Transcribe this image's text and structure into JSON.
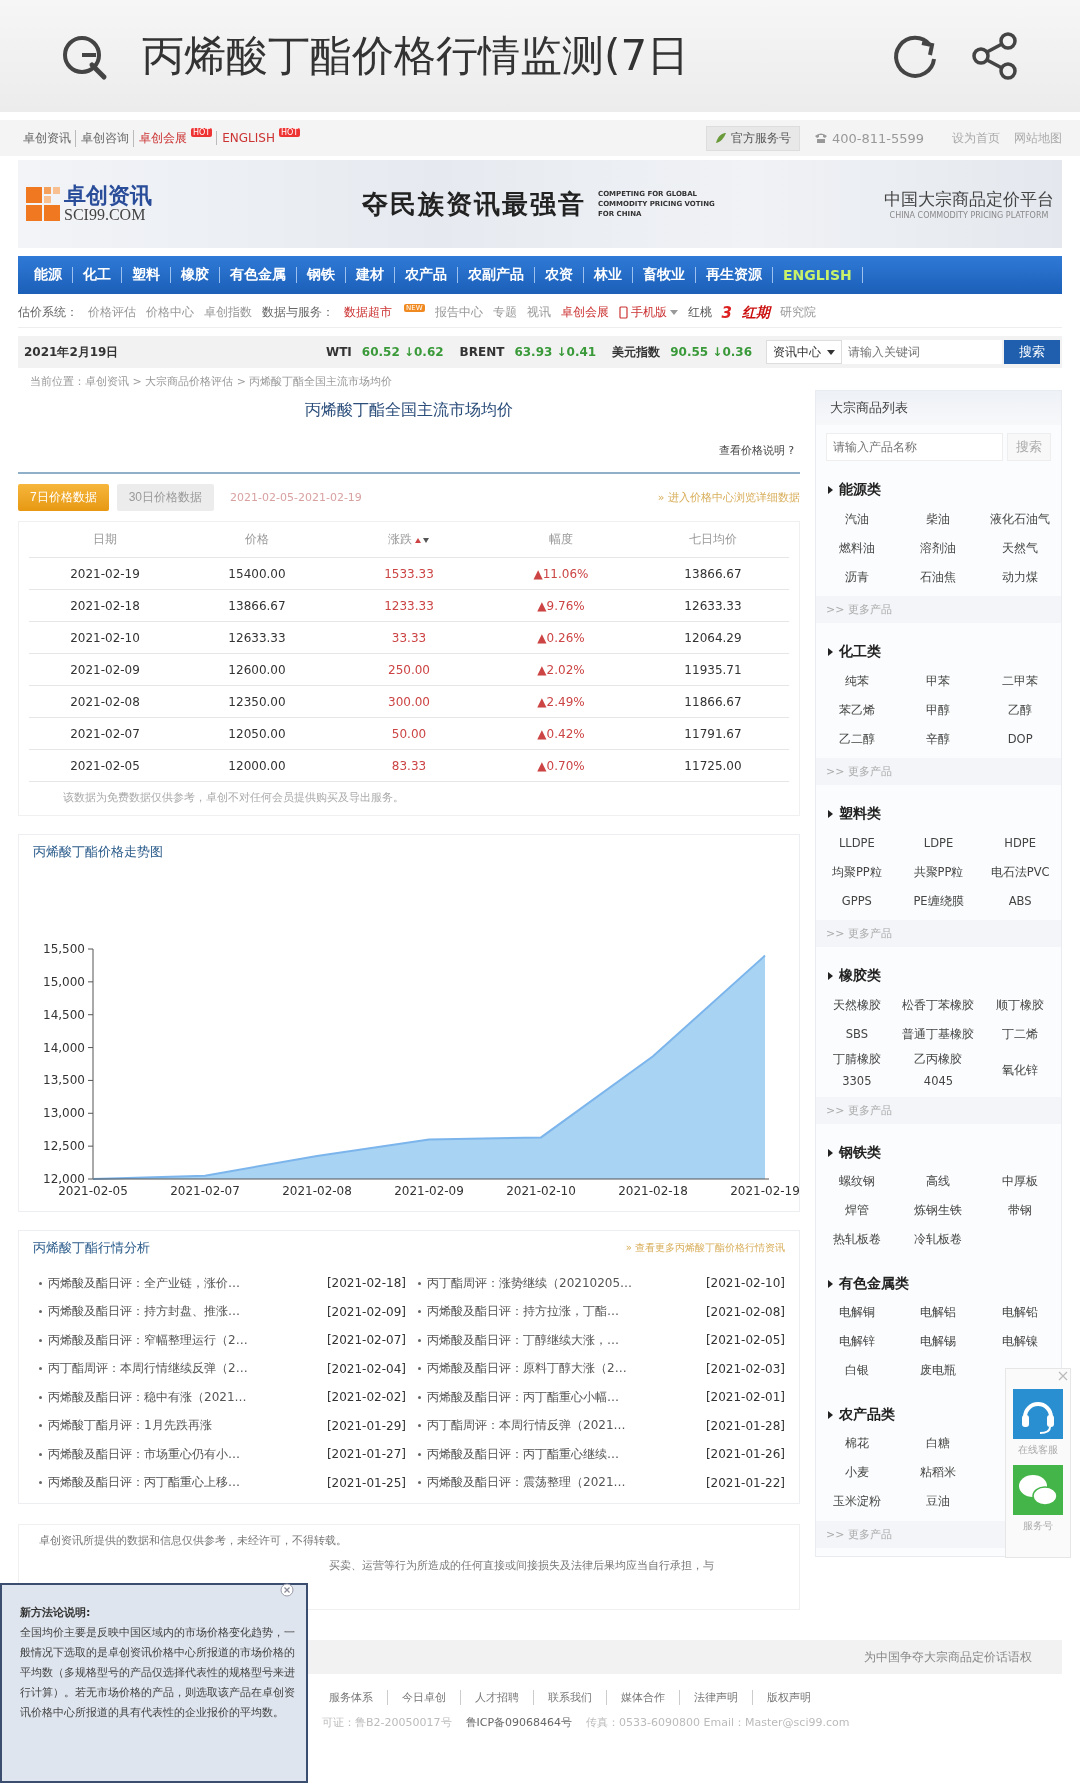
{
  "browser": {
    "title": "丙烯酸丁酯价格行情监测(7日"
  },
  "top_bar": {
    "links": [
      {
        "label": "卓创资讯",
        "kind": "plain"
      },
      {
        "label": "卓创咨询",
        "kind": "plain"
      },
      {
        "label": "卓创会展",
        "kind": "hot",
        "badge": "HOT"
      },
      {
        "label": "ENGLISH",
        "kind": "hot",
        "badge": "HOT"
      }
    ],
    "service_button": "官方服务号",
    "phone": "400-811-5599",
    "right_links": [
      "设为首页",
      "网站地图"
    ]
  },
  "banner": {
    "logo_cn": "卓创资讯",
    "logo_en": "SCI99.COM",
    "slogan": "夺民族资讯最强音",
    "slogan_en": [
      "COMPETING FOR GLOBAL",
      "COMMODITY PRICING VOTING",
      "FOR CHINA"
    ],
    "platform": "中国大宗商品定价平台",
    "platform_en": "CHINA COMMODITY PRICING PLATFORM"
  },
  "nav": [
    {
      "label": "能源",
      "kind": "category"
    },
    {
      "label": "化工",
      "kind": "category"
    },
    {
      "label": "塑料",
      "kind": "category"
    },
    {
      "label": "橡胶",
      "kind": "category"
    },
    {
      "label": "有色金属",
      "kind": "category"
    },
    {
      "label": "钢铁",
      "kind": "category"
    },
    {
      "label": "建材",
      "kind": "category"
    },
    {
      "label": "农产品",
      "kind": "category"
    },
    {
      "label": "农副产品",
      "kind": "category"
    },
    {
      "label": "农资",
      "kind": "category"
    },
    {
      "label": "林业",
      "kind": "category"
    },
    {
      "label": "畜牧业",
      "kind": "category"
    },
    {
      "label": "再生资源",
      "kind": "category"
    },
    {
      "label": "ENGLISH",
      "kind": "language"
    }
  ],
  "subnav": [
    {
      "label": "估价系统：",
      "kind": "label"
    },
    {
      "label": "价格评估",
      "kind": "link"
    },
    {
      "label": "价格中心",
      "kind": "link"
    },
    {
      "label": "卓创指数",
      "kind": "link"
    },
    {
      "label": "数据与服务：",
      "kind": "label"
    },
    {
      "label": "数据超市",
      "kind": "hot",
      "badge": "NEW"
    },
    {
      "label": "报告中心",
      "kind": "link"
    },
    {
      "label": "专题",
      "kind": "link"
    },
    {
      "label": "视讯",
      "kind": "link"
    },
    {
      "label": "卓创会展",
      "kind": "hot"
    },
    {
      "label": "手机版",
      "kind": "mobile"
    },
    {
      "label": "红桃",
      "kind": "brand",
      "mark": "3"
    },
    {
      "label": "红期",
      "kind": "logo"
    },
    {
      "label": "研究院",
      "kind": "link"
    }
  ],
  "ticker": {
    "date": "2021年2月19日",
    "quotes": [
      {
        "name": "WTI",
        "value": "60.52",
        "change": "↓0.62"
      },
      {
        "name": "BRENT",
        "value": "63.93",
        "change": "↓0.41"
      },
      {
        "name": "美元指数",
        "value": "90.55",
        "change": "↓0.36"
      }
    ],
    "dropdown": "资讯中心",
    "search_placeholder": "请输入关键词",
    "search_button": "搜索"
  },
  "breadcrumb": "当前位置：卓创资讯 > 大宗商品价格评估 > 丙烯酸丁酯全国主流市场均价",
  "price": {
    "title": "丙烯酸丁酯全国主流市场均价",
    "help_link": "查看价格说明 ?",
    "tabs": [
      {
        "label": "7日价格数据",
        "selected": true
      },
      {
        "label": "30日价格数据",
        "selected": false
      }
    ],
    "range": "2021-02-05-2021-02-19",
    "detail_link": "» 进入价格中心浏览详细数据",
    "columns": [
      "日期",
      "价格",
      "涨跌",
      "幅度",
      "七日均价"
    ],
    "rows": [
      {
        "date": "2021-02-19",
        "price": "15400.00",
        "change": "1533.33",
        "pct": "▲11.06%",
        "avg": "13866.67"
      },
      {
        "date": "2021-02-18",
        "price": "13866.67",
        "change": "1233.33",
        "pct": "▲9.76%",
        "avg": "12633.33"
      },
      {
        "date": "2021-02-10",
        "price": "12633.33",
        "change": "33.33",
        "pct": "▲0.26%",
        "avg": "12064.29"
      },
      {
        "date": "2021-02-09",
        "price": "12600.00",
        "change": "250.00",
        "pct": "▲2.02%",
        "avg": "11935.71"
      },
      {
        "date": "2021-02-08",
        "price": "12350.00",
        "change": "300.00",
        "pct": "▲2.49%",
        "avg": "11866.67"
      },
      {
        "date": "2021-02-07",
        "price": "12050.00",
        "change": "50.00",
        "pct": "▲0.42%",
        "avg": "11791.67"
      },
      {
        "date": "2021-02-05",
        "price": "12000.00",
        "change": "83.33",
        "pct": "▲0.70%",
        "avg": "11725.00"
      }
    ],
    "note": "该数据为免费数据仅供参考，卓创不对任何会员提供购买及导出服务。"
  },
  "chart": {
    "title": "丙烯酸丁酯价格走势图",
    "chart_data": {
      "type": "area",
      "categories": [
        "2021-02-05",
        "2021-02-07",
        "2021-02-08",
        "2021-02-09",
        "2021-02-10",
        "2021-02-18",
        "2021-02-19"
      ],
      "series": [
        {
          "color": "#a8d3f2",
          "values": [
            12000,
            12050,
            12350,
            12600,
            12633,
            13867,
            15400
          ]
        }
      ],
      "ylim": [
        12000,
        15500
      ],
      "yticks": [
        {
          "value": 12000,
          "label": "12,000"
        },
        {
          "value": 12500,
          "label": "12,500"
        },
        {
          "value": 13000,
          "label": "13,000"
        },
        {
          "value": 13500,
          "label": "13,500"
        },
        {
          "value": 14000,
          "label": "14,000"
        },
        {
          "value": 14500,
          "label": "14,500"
        },
        {
          "value": 15000,
          "label": "15,000"
        },
        {
          "value": 15500,
          "label": "15,500"
        }
      ]
    }
  },
  "analysis": {
    "title": "丙烯酸丁酯行情分析",
    "more_link": "» 查看更多丙烯酸丁酯价格行情资讯",
    "items": [
      {
        "title": "丙烯酸及酯日评：全产业链，涨价…",
        "date": "[2021-02-18]"
      },
      {
        "title": "丙丁酯周评：涨势继续（20210205…",
        "date": "[2021-02-10]"
      },
      {
        "title": "丙烯酸及酯日评：持方封盘、推涨…",
        "date": "[2021-02-09]"
      },
      {
        "title": "丙烯酸及酯日评：持方拉涨，丁酯…",
        "date": "[2021-02-08]"
      },
      {
        "title": "丙烯酸及酯日评：窄幅整理运行（2…",
        "date": "[2021-02-07]"
      },
      {
        "title": "丙烯酸及酯日评：丁醇继续大涨，…",
        "date": "[2021-02-05]"
      },
      {
        "title": "丙丁酯周评：本周行情继续反弹（2…",
        "date": "[2021-02-04]"
      },
      {
        "title": "丙烯酸及酯日评：原料丁醇大涨（2…",
        "date": "[2021-02-03]"
      },
      {
        "title": "丙烯酸及酯日评：稳中有涨（2021…",
        "date": "[2021-02-02]"
      },
      {
        "title": "丙烯酸及酯日评：丙丁酯重心小幅…",
        "date": "[2021-02-01]"
      },
      {
        "title": "丙烯酸丁酯月评：1月先跌再涨",
        "date": "[2021-01-29]"
      },
      {
        "title": "丙丁酯周评：本周行情反弹（2021…",
        "date": "[2021-01-28]"
      },
      {
        "title": "丙烯酸及酯日评：市场重心仍有小…",
        "date": "[2021-01-27]"
      },
      {
        "title": "丙烯酸及酯日评：丙丁酯重心继续…",
        "date": "[2021-01-26]"
      },
      {
        "title": "丙烯酸及酯日评：丙丁酯重心上移…",
        "date": "[2021-01-25]"
      },
      {
        "title": "丙烯酸及酯日评：震荡整理（2021…",
        "date": "[2021-01-22]"
      }
    ]
  },
  "sidebar": {
    "title": "大宗商品列表",
    "search_placeholder": "请输入产品名称",
    "search_button": "搜索",
    "sections": [
      {
        "name": "能源类",
        "rows": [
          [
            "汽油",
            "柴油",
            "液化石油气"
          ],
          [
            "燃料油",
            "溶剂油",
            "天然气"
          ],
          [
            "沥青",
            "石油焦",
            "动力煤"
          ]
        ],
        "more": ">> 更多产品"
      },
      {
        "name": "化工类",
        "rows": [
          [
            "纯苯",
            "甲苯",
            "二甲苯"
          ],
          [
            "苯乙烯",
            "甲醇",
            "乙醇"
          ],
          [
            "乙二醇",
            "辛醇",
            "DOP"
          ]
        ],
        "more": ">> 更多产品"
      },
      {
        "name": "塑料类",
        "rows": [
          [
            "LLDPE",
            "LDPE",
            "HDPE"
          ],
          [
            "均聚PP粒",
            "共聚PP粒",
            "电石法PVC"
          ],
          [
            "GPPS",
            "PE缠绕膜",
            "ABS"
          ]
        ],
        "more": ">> 更多产品"
      },
      {
        "name": "橡胶类",
        "rows": [
          [
            "天然橡胶",
            "松香丁苯橡胶",
            "顺丁橡胶"
          ],
          [
            "SBS",
            "普通丁基橡胶",
            "丁二烯"
          ],
          [
            "丁腈橡胶\n3305",
            "乙丙橡胶\n4045",
            "氧化锌"
          ]
        ],
        "more": ">> 更多产品"
      },
      {
        "name": "钢铁类",
        "rows": [
          [
            "螺纹钢",
            "高线",
            "中厚板"
          ],
          [
            "焊管",
            "炼钢生铁",
            "带钢"
          ],
          [
            "热轧板卷",
            "冷轧板卷"
          ]
        ]
      },
      {
        "name": "有色金属类",
        "rows": [
          [
            "电解铜",
            "电解铝",
            "电解铅"
          ],
          [
            "电解锌",
            "电解锡",
            "电解镍"
          ],
          [
            "白银",
            "废电瓶"
          ]
        ]
      },
      {
        "name": "农产品类",
        "rows": [
          [
            "棉花",
            "白糖"
          ],
          [
            "小麦",
            "粘稻米"
          ],
          [
            "玉米淀粉",
            "豆油"
          ]
        ],
        "more": ">> 更多产品"
      }
    ]
  },
  "float_widget": {
    "service": "在线客服",
    "wechat": "服务号"
  },
  "disclaimer": [
    "卓创资讯所提供的数据和信息仅供参考，未经许可，不得转载。",
    "买卖、运营等行为所造成的任何直接或间接损失及法律后果均应当自行承担，与"
  ],
  "slogan": "为中国争夺大宗商品定价话语权",
  "footer": {
    "links": [
      "服务体系",
      "今日卓创",
      "人才招聘",
      "联系我们",
      "媒体合作",
      "法律声明",
      "版权声明"
    ],
    "license": [
      "可证：鲁B2-20050017号",
      "鲁ICP备09068464号",
      "传真：0533-6090800 Email：Master@sci99.com"
    ]
  },
  "popup": {
    "title": "新方法论说明:",
    "body": "全国均价主要是反映中国区域内的市场价格变化趋势，一般情况下选取的是卓创资讯价格中心所报道的市场价格的平均数（多规格型号的产品仅选择代表性的规格型号来进行计算）。若无市场价格的产品，则选取该产品在卓创资讯价格中心所报道的具有代表性的企业报价的平均数。"
  }
}
